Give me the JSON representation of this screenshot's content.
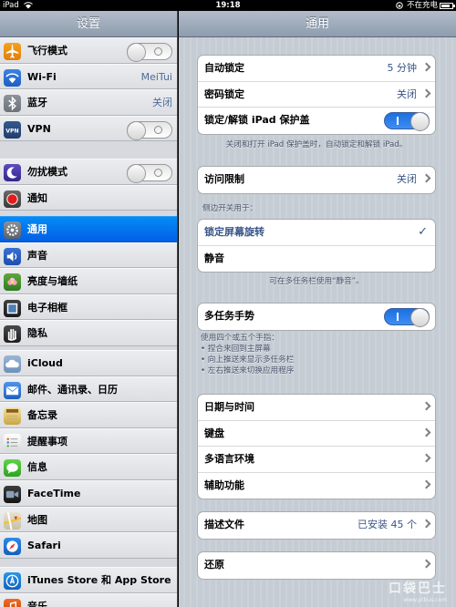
{
  "status_bar": {
    "device": "iPad",
    "time": "19:18",
    "charging": "不在充电"
  },
  "master": {
    "title": "设置",
    "groups": [
      [
        {
          "label": "飞行模式",
          "icon": "airplane-icon",
          "accessory": "switch-off"
        },
        {
          "label": "Wi-Fi",
          "icon": "wifi-icon",
          "value": "MeiTui"
        },
        {
          "label": "蓝牙",
          "icon": "bluetooth-icon",
          "value": "关闭"
        },
        {
          "label": "VPN",
          "icon": "vpn-icon",
          "accessory": "switch-off"
        }
      ],
      [
        {
          "label": "勿扰模式",
          "icon": "moon-icon",
          "accessory": "switch-off"
        },
        {
          "label": "通知",
          "icon": "notification-icon"
        }
      ],
      [
        {
          "label": "通用",
          "icon": "gear-icon",
          "selected": true
        },
        {
          "label": "声音",
          "icon": "speaker-icon"
        },
        {
          "label": "亮度与墙纸",
          "icon": "flower-icon"
        },
        {
          "label": "电子相框",
          "icon": "picture-frame-icon"
        },
        {
          "label": "隐私",
          "icon": "hand-icon"
        }
      ],
      [
        {
          "label": "iCloud",
          "icon": "cloud-icon"
        },
        {
          "label": "邮件、通讯录、日历",
          "icon": "mail-icon"
        },
        {
          "label": "备忘录",
          "icon": "notes-icon"
        },
        {
          "label": "提醒事项",
          "icon": "reminders-icon"
        },
        {
          "label": "信息",
          "icon": "messages-icon"
        },
        {
          "label": "FaceTime",
          "icon": "facetime-icon"
        },
        {
          "label": "地图",
          "icon": "maps-icon"
        },
        {
          "label": "Safari",
          "icon": "safari-icon"
        }
      ],
      [
        {
          "label": "iTunes Store 和 App Store",
          "icon": "app-store-icon"
        },
        {
          "label": "音乐",
          "icon": "music-icon"
        }
      ]
    ]
  },
  "detail": {
    "title": "通用",
    "auto_lock": {
      "label": "自动锁定",
      "value": "5 分钟"
    },
    "passcode_lock": {
      "label": "密码锁定",
      "value": "关闭"
    },
    "cover_lock": {
      "label": "锁定/解锁 iPad 保护盖"
    },
    "cover_note": "关闭和打开 iPad 保护盖时，自动锁定和解锁 iPad。",
    "restrictions": {
      "label": "访问限制",
      "value": "关闭"
    },
    "side_switch_header": "侧边开关用于：",
    "lock_rotation": {
      "label": "锁定屏幕旋转"
    },
    "mute": {
      "label": "静音"
    },
    "mute_note": "可在多任务栏使用“静音”。",
    "multitasking": {
      "label": "多任务手势"
    },
    "multitasking_note": {
      "intro": "使用四个或五个手指：",
      "line1": "• 捏合来回到主屏幕",
      "line2": "• 向上推送来显示多任务栏",
      "line3": "• 左右推送来切换应用程序"
    },
    "date_time": {
      "label": "日期与时间"
    },
    "keyboard": {
      "label": "键盘"
    },
    "international": {
      "label": "多语言环境"
    },
    "accessibility": {
      "label": "辅助功能"
    },
    "profiles": {
      "label": "描述文件",
      "value": "已安装 45 个"
    },
    "reset": {
      "label": "还原"
    }
  },
  "watermark": {
    "text": "口袋巴士",
    "url": "www.ptbus.com"
  }
}
